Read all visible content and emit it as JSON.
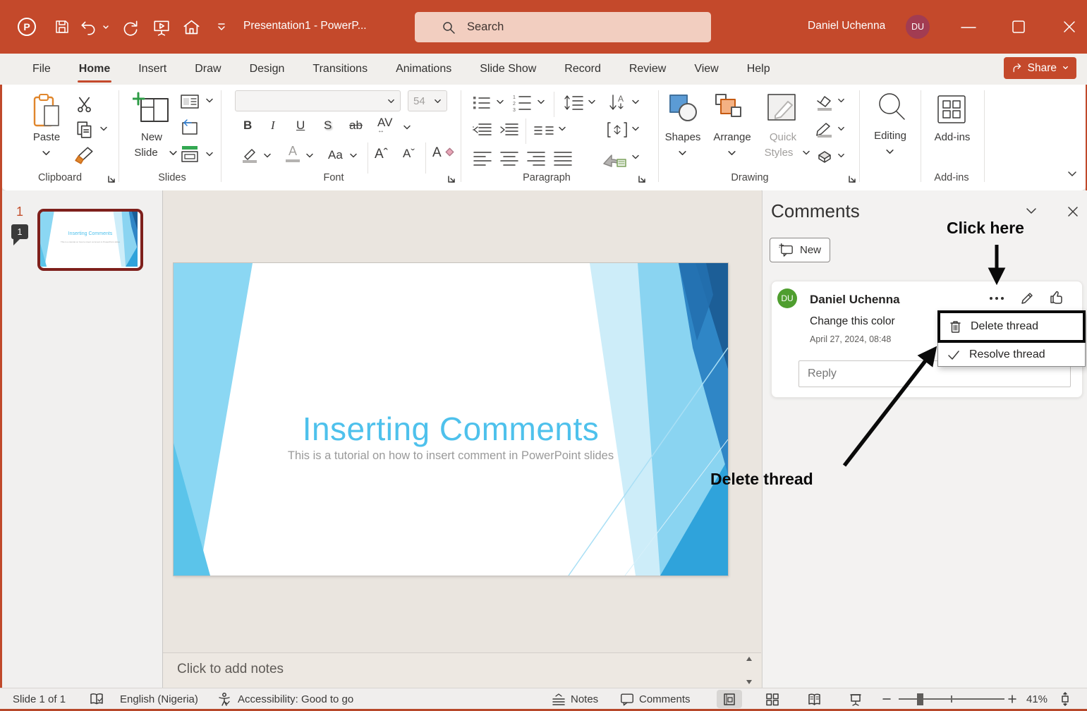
{
  "titlebar": {
    "title": "Presentation1  -  PowerP...",
    "search_placeholder": "Search",
    "user_name": "Daniel Uchenna",
    "user_initials": "DU"
  },
  "menu": {
    "tabs": [
      "File",
      "Home",
      "Insert",
      "Draw",
      "Design",
      "Transitions",
      "Animations",
      "Slide Show",
      "Record",
      "Review",
      "View",
      "Help"
    ],
    "active_tab": "Home",
    "share_label": "Share"
  },
  "ribbon": {
    "paste_label": "Paste",
    "new_label": "New",
    "slide_label": "Slide",
    "font_size": "54",
    "font": {
      "bold": "B",
      "italic": "I",
      "underline": "U",
      "shadow": "S",
      "strike": "ab",
      "spacing": "AV",
      "case": "Aa",
      "grow": "Aˆ",
      "shrink": "Aˇ",
      "clear": "A"
    },
    "shapes_label": "Shapes",
    "arrange_label": "Arrange",
    "quick_label": "Quick",
    "styles_label": "Styles",
    "editing_label": "Editing",
    "addins_label": "Add-ins",
    "groups": {
      "clipboard": "Clipboard",
      "slides": "Slides",
      "font": "Font",
      "paragraph": "Paragraph",
      "drawing": "Drawing",
      "addins": "Add-ins"
    }
  },
  "thumbnail_panel": {
    "slide_number": "1",
    "comment_badge": "1"
  },
  "slide": {
    "title": "Inserting Comments",
    "subtitle": "This is a tutorial on how to insert comment in PowerPoint slides",
    "title_color": "#4EC1EC"
  },
  "notes": {
    "placeholder": "Click to add notes"
  },
  "comments_panel": {
    "title": "Comments",
    "new_button": "New",
    "comment": {
      "author": "Daniel Uchenna",
      "initials": "DU",
      "text": "Change this color",
      "date": "April 27, 2024, 08:48",
      "reply_placeholder": "Reply"
    },
    "menu": {
      "delete": "Delete thread",
      "resolve": "Resolve thread"
    }
  },
  "annotations": {
    "click_here": "Click here",
    "delete_thread": "Delete thread"
  },
  "statusbar": {
    "slide_info": "Slide 1 of 1",
    "language": "English (Nigeria)",
    "accessibility": "Accessibility: Good to go",
    "notes_label": "Notes",
    "comments_label": "Comments",
    "zoom_level": "41%"
  },
  "colors": {
    "accent": "#C4492B",
    "slide_title": "#4EC1EC",
    "comment_avatar": "#4F9E2F",
    "titlebar_avatar": "#A23C52"
  }
}
